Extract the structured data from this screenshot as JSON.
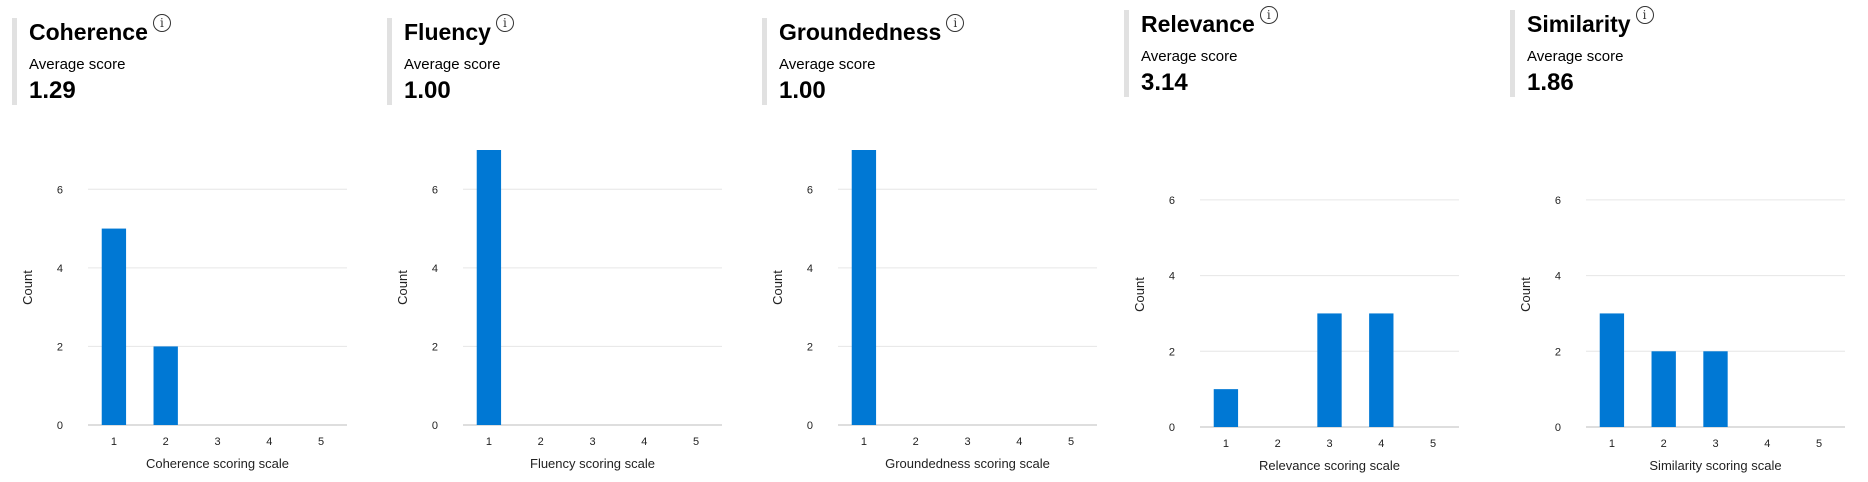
{
  "colors": {
    "bar": "#0078d4",
    "grid": "#e6e6e6",
    "axis": "#bdbdbd"
  },
  "panels": [
    {
      "title": "Coherence",
      "info_icon": "info-icon",
      "avg_label": "Average score",
      "avg_value": "1.29"
    },
    {
      "title": "Fluency",
      "info_icon": "info-icon",
      "avg_label": "Average score",
      "avg_value": "1.00"
    },
    {
      "title": "Groundedness",
      "info_icon": "info-icon",
      "avg_label": "Average score",
      "avg_value": "1.00"
    },
    {
      "title": "Relevance",
      "info_icon": "info-icon",
      "avg_label": "Average score",
      "avg_value": "3.14"
    },
    {
      "title": "Similarity",
      "info_icon": "info-icon",
      "avg_label": "Average score",
      "avg_value": "1.86"
    }
  ],
  "chart_data": [
    {
      "type": "bar",
      "categories": [
        "1",
        "2",
        "3",
        "4",
        "5"
      ],
      "values": [
        5,
        2,
        0,
        0,
        0
      ],
      "xlabel": "Coherence scoring scale",
      "ylabel": "Count",
      "ylim": [
        0,
        7
      ],
      "yticks": [
        0,
        2,
        4,
        6
      ],
      "grid": true
    },
    {
      "type": "bar",
      "categories": [
        "1",
        "2",
        "3",
        "4",
        "5"
      ],
      "values": [
        7,
        0,
        0,
        0,
        0
      ],
      "xlabel": "Fluency scoring scale",
      "ylabel": "Count",
      "ylim": [
        0,
        7
      ],
      "yticks": [
        0,
        2,
        4,
        6
      ],
      "grid": true
    },
    {
      "type": "bar",
      "categories": [
        "1",
        "2",
        "3",
        "4",
        "5"
      ],
      "values": [
        7,
        0,
        0,
        0,
        0
      ],
      "xlabel": "Groundedness scoring scale",
      "ylabel": "Count",
      "ylim": [
        0,
        7
      ],
      "yticks": [
        0,
        2,
        4,
        6
      ],
      "grid": true
    },
    {
      "type": "bar",
      "categories": [
        "1",
        "2",
        "3",
        "4",
        "5"
      ],
      "values": [
        1,
        0,
        3,
        3,
        0
      ],
      "xlabel": "Relevance scoring scale",
      "ylabel": "Count",
      "ylim": [
        0,
        7
      ],
      "yticks": [
        0,
        2,
        4,
        6
      ],
      "grid": true
    },
    {
      "type": "bar",
      "categories": [
        "1",
        "2",
        "3",
        "4",
        "5"
      ],
      "values": [
        3,
        2,
        2,
        0,
        0
      ],
      "xlabel": "Similarity scoring scale",
      "ylabel": "Count",
      "ylim": [
        0,
        7
      ],
      "yticks": [
        0,
        2,
        4,
        6
      ],
      "grid": true
    }
  ]
}
